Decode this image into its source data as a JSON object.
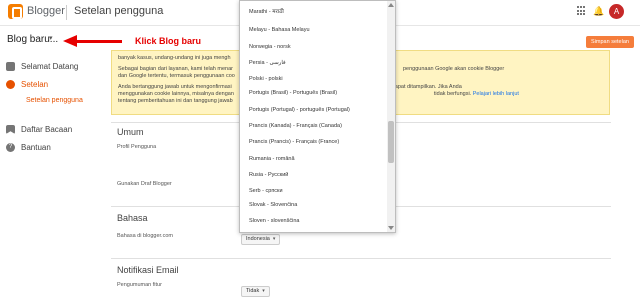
{
  "header": {
    "brand": "Blogger",
    "title": "Setelan pengguna",
    "bell_glyph": "🔔",
    "avatar_letter": "A",
    "icons": [
      "apps-icon",
      "bell-icon"
    ]
  },
  "subbar": {
    "blog_selector": "Blog baru...",
    "caret": "▾",
    "annotation": "Klick Blog baru",
    "save_button": "Simpan setelan"
  },
  "sidebar": {
    "items": [
      {
        "label": "Selamat Datang",
        "icon": "welcome-icon"
      },
      {
        "label": "Setelan",
        "icon": "gear-icon",
        "active": true
      },
      {
        "label": "Daftar Bacaan",
        "icon": "bookmark-icon"
      },
      {
        "label": "Bantuan",
        "icon": "help-icon"
      }
    ],
    "sub_item": "Setelan pengguna",
    "help_glyph": "?"
  },
  "notice": {
    "line1": "banyak kasus, undang-undang ini juga mengh",
    "para2": "Sebagai bagian dari layanan, kami telah menar",
    "para2b": "penggunaan Google akan cookie Blogger",
    "para2c": "dan Google tertentu, termasuk penggunaan coo",
    "para3": "Anda bertanggung jawab untuk mengonfirmasi",
    "para3b": "dapat ditampilkan. Jika Anda",
    "para3c": "menggunakan cookie lainnya, misalnya dengan",
    "para3d": "tidak berfungsi.",
    "link": "Pelajari lebih lanjut",
    "para3e": "tentang pemberitahuan ini dan tanggung jawab"
  },
  "sections": {
    "umum": "Umum",
    "profil_label": "Profil Pengguna",
    "draft_label": "Gunakan Draf Blogger",
    "bahasa": "Bahasa",
    "bahasa_label": "Bahasa di blogger.com",
    "bahasa_value": "Indonesia",
    "notif": "Notifikasi Email",
    "notif_label": "Pengumuman fitur",
    "notif_value": "Tidak",
    "pill_caret": "▾"
  },
  "dropdown": {
    "items": [
      "Marathi - मराठी",
      "Melayu - Bahasa Melayu",
      "Norwegia - norsk",
      "Persia - فارسی",
      "Polski - polski",
      "Portugis (Brasil) - Português (Brasil)",
      "Portugis (Portugal) - português (Portugal)",
      "Prancis (Kanada) - Français (Canada)",
      "Prancis (Prancis) - Français (France)",
      "Rumania - română",
      "Rusia - Русский",
      "Serb - српски",
      "Slovak - Slovenčina",
      "Sloven - slovenščina"
    ]
  },
  "colors": {
    "accent": "#f57d00",
    "annotation": "#e60000",
    "active_nav": "#e65100",
    "notice_bg": "#fff4c2"
  }
}
